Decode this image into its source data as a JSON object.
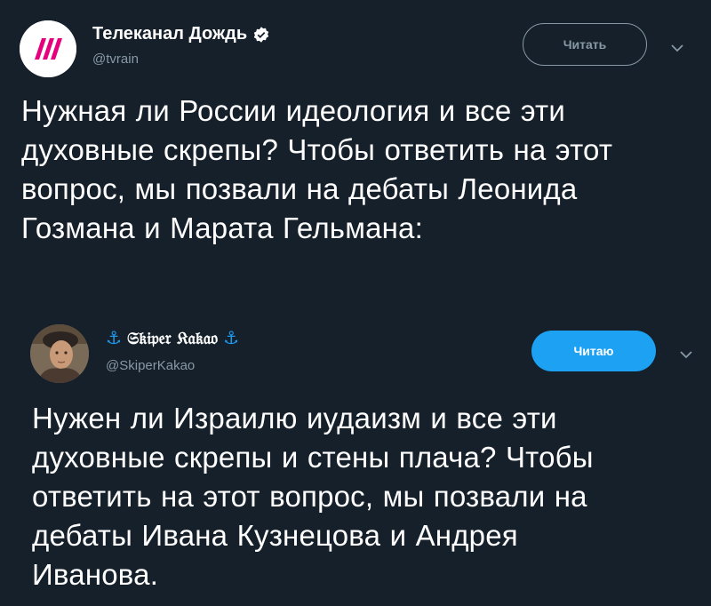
{
  "tweets": [
    {
      "display_name": "Телеканал Дождь",
      "handle": "@tvrain",
      "verified": true,
      "follow_button": "Читать",
      "follow_state": "not-following",
      "text_lines": [
        "Нужная ли России идеология и все эти",
        "духовные скрепы? Чтобы ответить на этот",
        "вопрос, мы позвали на дебаты Леонида",
        "Гозмана и Марата Гельмана:"
      ]
    },
    {
      "display_name": "𝔖𝔨𝔦𝔭𝔢𝔯 𝔎𝔞𝔨𝔞𝔬",
      "name_prefix_icon": "⚓",
      "name_suffix_icon": "⚓",
      "handle": "@SkiperKakao",
      "follow_button": "Читаю",
      "follow_state": "following",
      "text_lines": [
        "Нужен ли Израилю иудаизм и все эти",
        "духовные скрепы и стены плача? Чтобы",
        "ответить на этот вопрос, мы позвали на",
        "дебаты Ивана Кузнецова и Андрея",
        "Иванова."
      ]
    }
  ],
  "colors": {
    "background": "#15202b",
    "accent": "#1da1f2",
    "muted": "#8899a6",
    "tvrain_logo": "#e5007d"
  },
  "icons": {
    "verified": "verified-badge-icon",
    "chevron": "chevron-down-icon",
    "anchor": "anchor-icon"
  }
}
